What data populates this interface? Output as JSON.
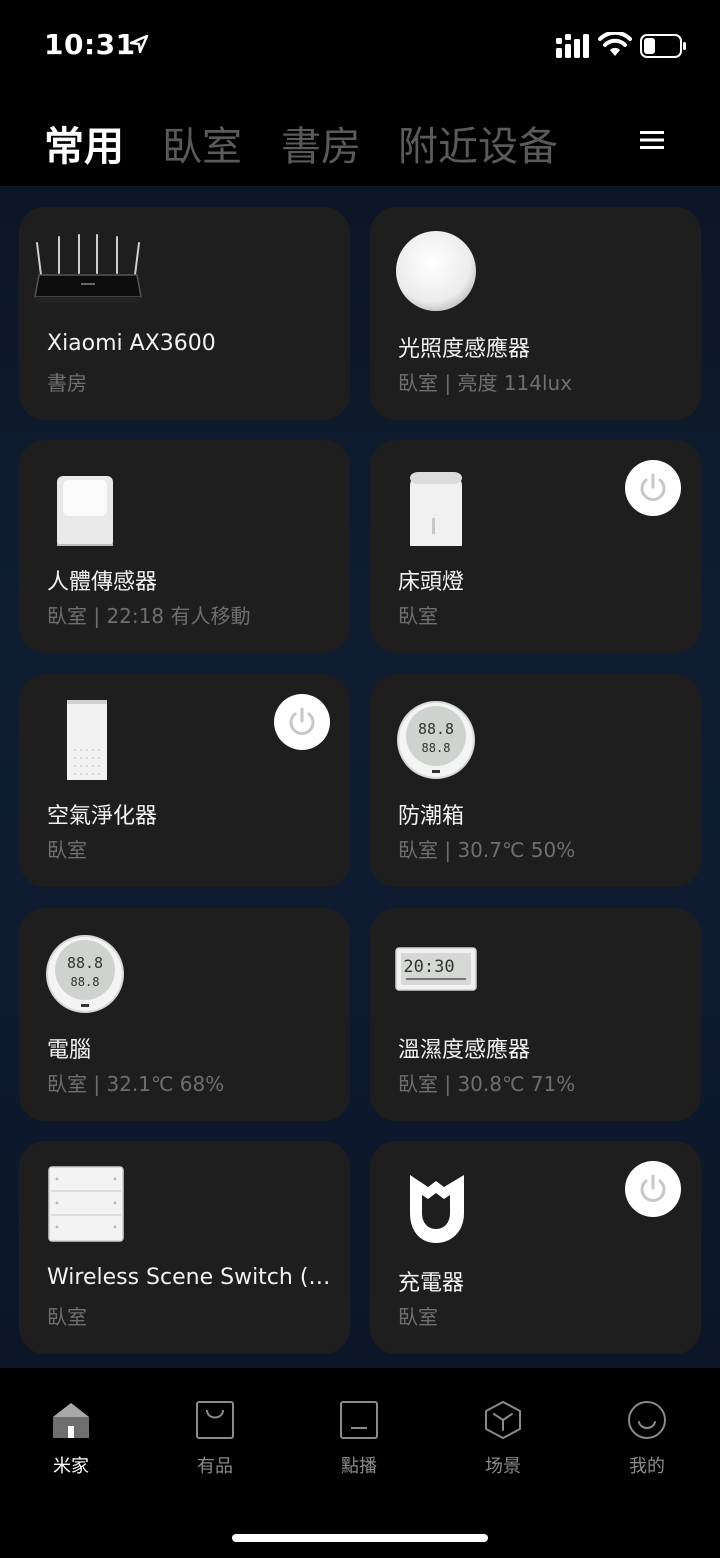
{
  "status_bar": {
    "time": "10:31"
  },
  "tabs": [
    {
      "label": "常用",
      "active": true
    },
    {
      "label": "臥室",
      "active": false
    },
    {
      "label": "書房",
      "active": false
    },
    {
      "label": "附近设备",
      "active": false
    }
  ],
  "devices": [
    {
      "name": "Xiaomi AX3600",
      "sub": "書房",
      "icon": "router-icon",
      "power": false
    },
    {
      "name": "光照度感應器",
      "sub": "臥室 | 亮度 114lux",
      "icon": "light-sensor-icon",
      "power": false
    },
    {
      "name": "人體傳感器",
      "sub": "臥室 | 22:18 有人移動",
      "icon": "motion-sensor-icon",
      "power": false
    },
    {
      "name": "床頭燈",
      "sub": "臥室",
      "icon": "bedside-lamp-icon",
      "power": true
    },
    {
      "name": "空氣淨化器",
      "sub": "臥室",
      "icon": "air-purifier-icon",
      "power": true
    },
    {
      "name": "防潮箱",
      "sub": "臥室 | 30.7℃ 50%",
      "icon": "hygrometer-icon",
      "power": false
    },
    {
      "name": "電腦",
      "sub": "臥室 | 32.1℃ 68%",
      "icon": "hygrometer-icon",
      "power": false
    },
    {
      "name": "溫濕度感應器",
      "sub": "臥室 | 30.8℃ 71%",
      "icon": "clock-hygrometer-icon",
      "power": false
    },
    {
      "name": "Wireless Scene Switch (Fo...",
      "sub": "臥室",
      "icon": "scene-switch-icon",
      "power": false
    },
    {
      "name": "充電器",
      "sub": "臥室",
      "icon": "mi-logo-icon",
      "power": true
    }
  ],
  "device_screens": {
    "hygro_top": "88.8",
    "hygro_bottom": "88.8",
    "clock_time": "20:30"
  },
  "nav": [
    {
      "label": "米家",
      "icon": "home-icon",
      "active": true
    },
    {
      "label": "有品",
      "icon": "shopping-bag-icon",
      "active": false
    },
    {
      "label": "點播",
      "icon": "media-icon",
      "active": false
    },
    {
      "label": "场景",
      "icon": "cube-icon",
      "active": false
    },
    {
      "label": "我的",
      "icon": "smile-face-icon",
      "active": false
    }
  ],
  "colors": {
    "card": "#1e1e1e",
    "inactive_text": "#5a5a5a",
    "sub_text": "#6f6f6f"
  }
}
